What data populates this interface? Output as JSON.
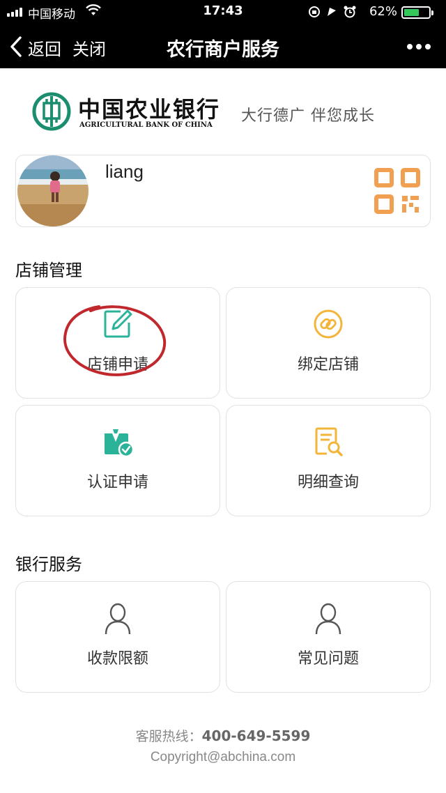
{
  "status_bar": {
    "carrier": "中国移动",
    "time": "17:43",
    "battery_percent": "62%",
    "battery_level": 0.62
  },
  "nav": {
    "back_label": "返回",
    "close_label": "关闭",
    "title": "农行商户服务"
  },
  "bank": {
    "name_cn": "中国农业银行",
    "name_en": "AGRICULTURAL BANK OF CHINA",
    "slogan": "大行德广  伴您成长",
    "brand_color": "#1a8e6e"
  },
  "profile": {
    "username": "liang",
    "qr_color": "#f0a050"
  },
  "sections": {
    "store": {
      "title": "店铺管理",
      "items": [
        {
          "label": "店铺申请",
          "icon": "edit-icon"
        },
        {
          "label": "绑定店铺",
          "icon": "link-icon"
        },
        {
          "label": "认证申请",
          "icon": "certify-icon"
        },
        {
          "label": "明细查询",
          "icon": "search-document-icon"
        }
      ]
    },
    "bank_service": {
      "title": "银行服务",
      "items": [
        {
          "label": "收款限额",
          "icon": "user-icon"
        },
        {
          "label": "常见问题",
          "icon": "user-icon"
        }
      ]
    }
  },
  "footer": {
    "hotline_label": "客服热线：",
    "hotline_number": "400-649-5599",
    "copyright": "Copyright@abchina.com"
  },
  "colors": {
    "teal": "#2bb39a",
    "gold": "#f2b53a",
    "annotation_red": "#c0282e"
  }
}
